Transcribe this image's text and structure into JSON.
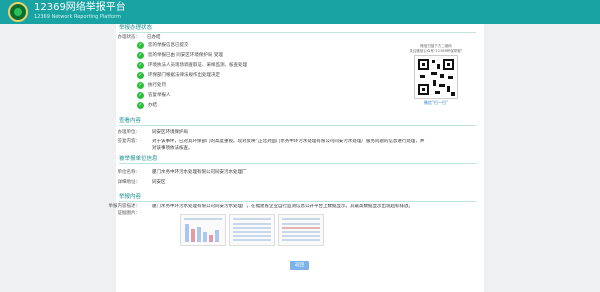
{
  "app": {
    "title": "12369网络举报平台",
    "subtitle": "12369 Network Reporting Platform"
  },
  "status_section": {
    "title": "举报办理状态",
    "state_label": "办理状态：",
    "state_value": "已办结",
    "steps": [
      "您的举报信息已提交",
      "您的举报已由 同安区环境保护局 受理",
      "环境执法人员现场调查取证、采样监测、核查处理",
      "环保部门根据法律法规作出处理决定",
      "执行处罚",
      "答复举报人",
      "办结"
    ]
  },
  "qr": {
    "caption_line1": "微信扫描下方二维码",
    "caption_line2": "关注微信公众号“12369环保举报”",
    "link_text": "微信“扫一扫”"
  },
  "content_section": {
    "title": "查看内容",
    "unit_label": "办理单位：",
    "unit_value": "同安区环境保护局",
    "reply_label": "答复内容：",
    "reply_value_line1": "对于该事件，已对其环保部门的高度重视。现对反映“正北对面门水务中环污水处理有限公司同安污水处理厂服务问题的信息进行处理，并",
    "reply_value_line2": "对该事项依法核查。"
  },
  "reported_section": {
    "title": "被举报单位信息",
    "name_label": "单位名称：",
    "name_value": "厦门水务中环污水处理有限公司同安污水处理厂",
    "address_label": "详细地址：",
    "address_value": "同安区"
  },
  "report_section": {
    "title": "举报内容",
    "text_label": "举报内容描述：",
    "text_value": "厦门水务中环污水处理有限公司同安污水处理厂，在福建省企业自行监测信息公开平台上数据显示，其最高数据显示出现超标排放。",
    "evidence_label": "证据图片："
  },
  "actions": {
    "return_label": "返回"
  },
  "colors": {
    "header": "#19a3a3",
    "accent": "#1a8f8f",
    "check": "#2ebd3b",
    "button": "#7cb3e8"
  }
}
